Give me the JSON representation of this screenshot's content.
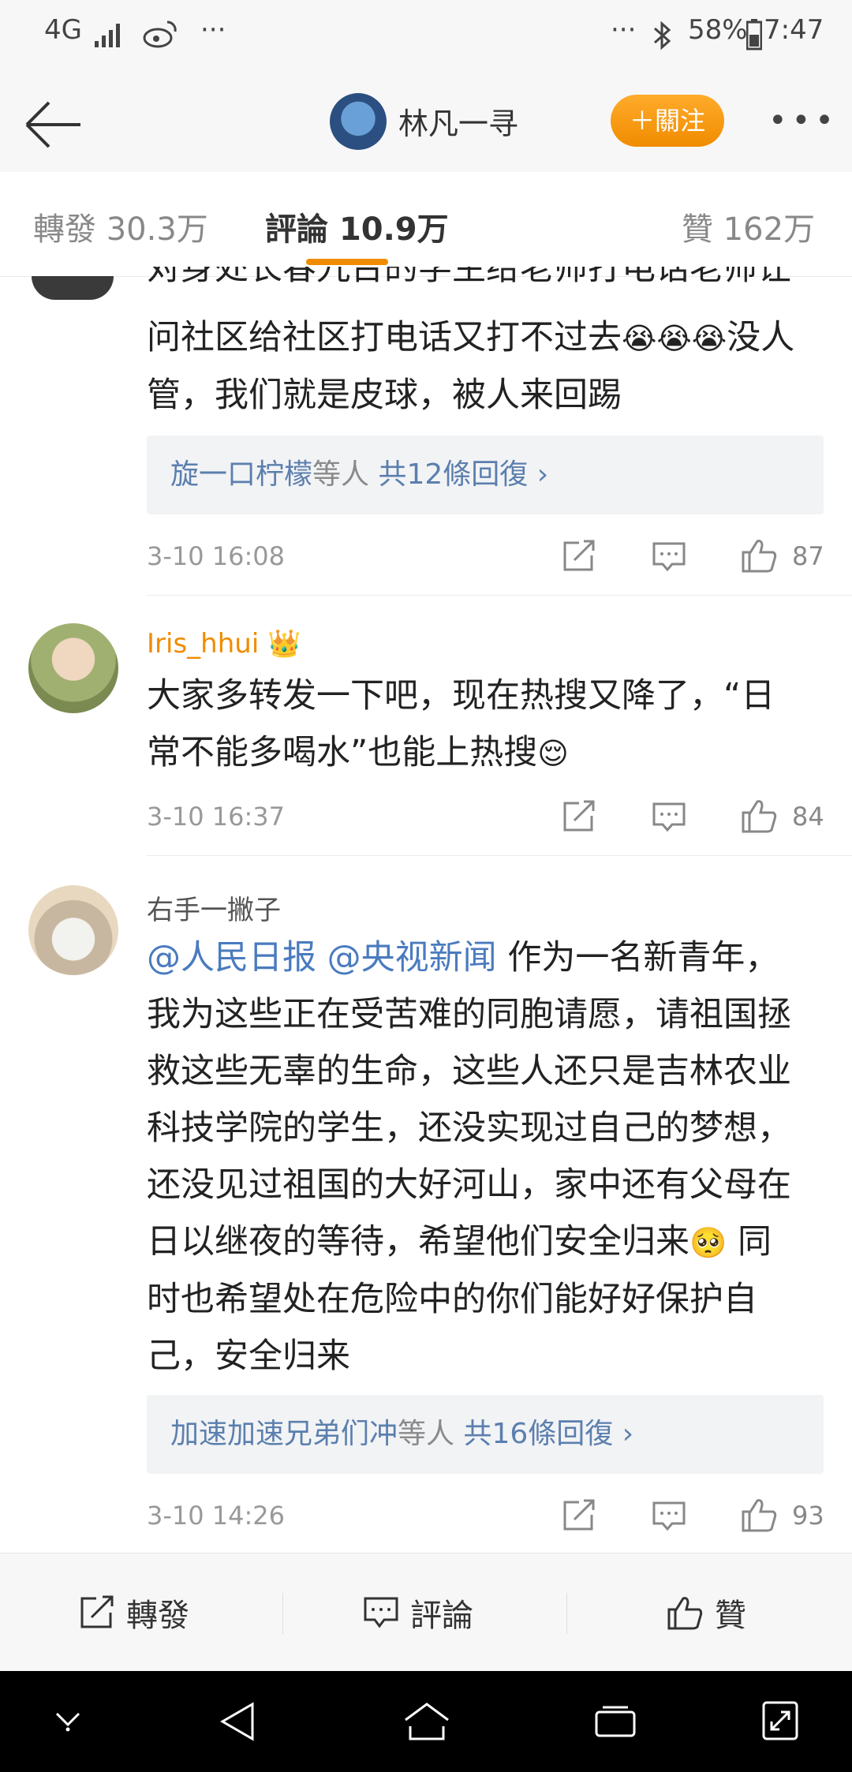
{
  "status_bar": {
    "network": "4G",
    "battery": "58%",
    "time": "7:47",
    "left_more": "···",
    "right_more": "···"
  },
  "header": {
    "username": "林凡一寻",
    "follow_label": "＋關注",
    "more_label": "•••"
  },
  "tabs": [
    {
      "label": "轉發",
      "count": "30.3万"
    },
    {
      "label": "評論",
      "count": "10.9万"
    },
    {
      "label": "贊",
      "count": "162万"
    }
  ],
  "comments": [
    {
      "text_cut": "对身处长春九台的学生给老师打电话老师让",
      "text_lines": [
        "问社区给社区打电话又打不过去",
        "没人",
        "管，我们就是皮球，被人来回踢"
      ],
      "reply_names": "旋一口柠檬",
      "reply_suffix": "等人",
      "reply_count": "共12條回復 ›",
      "timestamp": "3-10 16:08",
      "likes": "87"
    },
    {
      "username": "Iris_hhui",
      "text_lines": [
        "大家多转发一下吧，现在热搜又降了，“日",
        "常不能多喝水”也能上热搜"
      ],
      "timestamp": "3-10 16:37",
      "likes": "84"
    },
    {
      "username": "右手一撇子",
      "mention1": "@人民日报",
      "mention2": "@央视新闻",
      "text_first": " 作为一名新青年，",
      "text_lines": [
        "我为这些正在受苦难的同胞请愿，请祖国拯",
        "救这些无辜的生命，这些人还只是吉林农业",
        "科技学院的学生，还没实现过自己的梦想，",
        "还没见过祖国的大好河山，家中还有父母在",
        "日以继夜的等待，希望他们安全归来",
        " 同",
        "时也希望处在危险中的你们能好好保护自",
        "己，安全归来"
      ],
      "reply_names": "加速加速兄弟们冲",
      "reply_suffix": "等人",
      "reply_count": "共16條回復 ›",
      "timestamp": "3-10 14:26",
      "likes": "93"
    }
  ],
  "bottom_bar": {
    "repost": "轉發",
    "comment": "評論",
    "like": "贊"
  },
  "colors": {
    "accent": "#f08c00",
    "link": "#4a7bbf"
  }
}
